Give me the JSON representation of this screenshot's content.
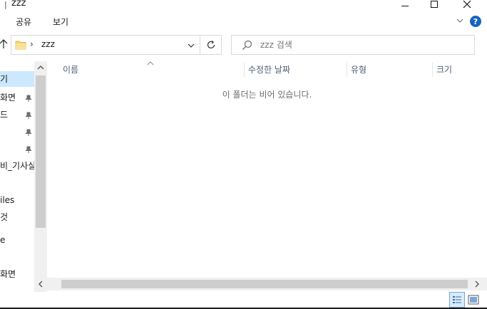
{
  "window": {
    "title": "zzz"
  },
  "ribbon": {
    "tabs": [
      {
        "label": "공유"
      },
      {
        "label": "보기"
      }
    ],
    "help_label": "?"
  },
  "address": {
    "crumb_separator": "›",
    "folder": "zzz"
  },
  "search": {
    "placeholder": "zzz 검색"
  },
  "nav": {
    "items": [
      {
        "label": "기",
        "selected": true,
        "pinned": false
      },
      {
        "label": "화면",
        "selected": false,
        "pinned": true
      },
      {
        "label": "드",
        "selected": false,
        "pinned": true
      },
      {
        "label": "",
        "selected": false,
        "pinned": true
      },
      {
        "label": "",
        "selected": false,
        "pinned": true
      },
      {
        "label": "비_기사실:",
        "selected": false,
        "pinned": false
      },
      {
        "label": "",
        "selected": false,
        "pinned": false
      },
      {
        "label": "iles",
        "selected": false,
        "pinned": false
      },
      {
        "label": "것",
        "selected": false,
        "pinned": false
      },
      {
        "label": "",
        "selected": false,
        "pinned": false
      },
      {
        "label": "e",
        "selected": false,
        "pinned": false
      },
      {
        "label": "",
        "selected": false,
        "pinned": false
      },
      {
        "label": "화면",
        "selected": false,
        "pinned": false
      }
    ]
  },
  "columns": {
    "name": "이름",
    "date": "수정한 날짜",
    "type": "유형",
    "size": "크기"
  },
  "content": {
    "empty_message": "이 폴더는 비어 있습니다."
  },
  "colors": {
    "selected_bg": "#cce8ff",
    "header_text": "#4c607a",
    "help_blue": "#1565c0",
    "folder_yellow": "#f8d775"
  }
}
